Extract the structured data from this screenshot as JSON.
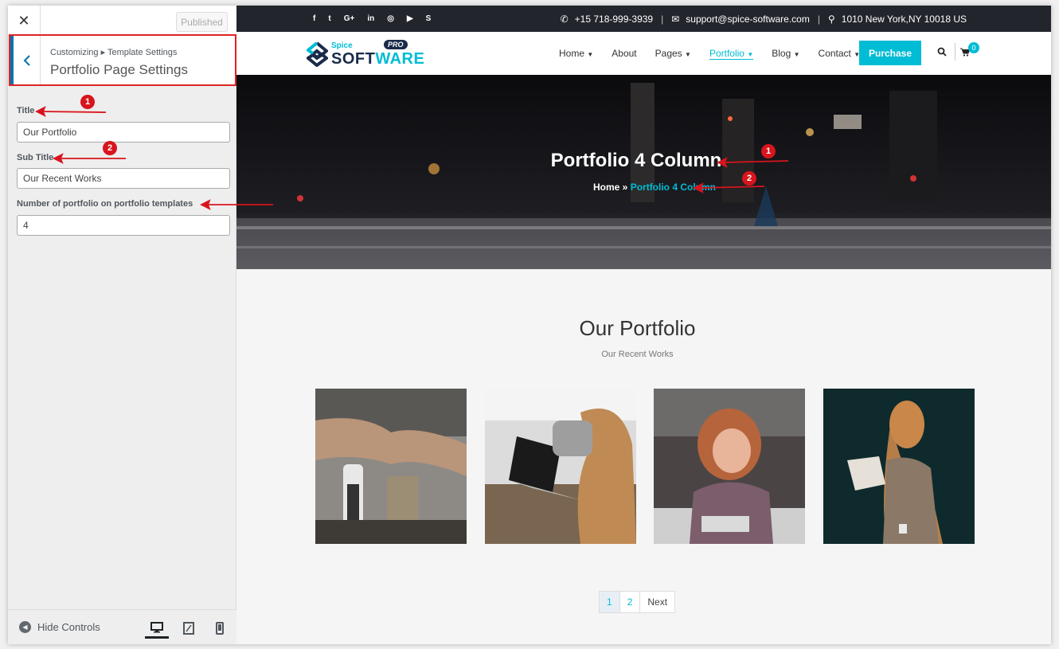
{
  "customizer": {
    "close_icon": "✕",
    "published_label": "Published",
    "breadcrumb": "Customizing ▸ Template Settings",
    "section_title": "Portfolio Page Settings",
    "controls": [
      {
        "label": "Title",
        "value": "Our Portfolio"
      },
      {
        "label": "Sub Title",
        "value": "Our Recent Works"
      },
      {
        "label": "Number of portfolio on portfolio templates",
        "value": "4"
      }
    ],
    "hide_controls_label": "Hide Controls",
    "devices": [
      "desktop",
      "tablet",
      "mobile"
    ]
  },
  "site": {
    "topbar": {
      "social_icons": [
        "facebook-icon",
        "twitter-icon",
        "google-plus-icon",
        "linkedin-icon",
        "instagram-icon",
        "youtube-icon",
        "skype-icon"
      ],
      "social_glyphs": [
        "f",
        "t",
        "G+",
        "in",
        "◎",
        "▶",
        "S"
      ],
      "phone": "+15 718-999-3939",
      "email": "support@spice-software.com",
      "address": "1010 New York,NY 10018 US"
    },
    "logo": {
      "small": "Spice",
      "big_left": "SOFT",
      "big_right": "WARE",
      "pro": "PRO"
    },
    "menu": [
      {
        "label": "Home",
        "dropdown": true
      },
      {
        "label": "About",
        "dropdown": false
      },
      {
        "label": "Pages",
        "dropdown": true
      },
      {
        "label": "Portfolio",
        "dropdown": true,
        "active": true
      },
      {
        "label": "Blog",
        "dropdown": true
      },
      {
        "label": "Contact",
        "dropdown": true
      }
    ],
    "purchase_label": "Purchase",
    "cart_count": "0",
    "hero": {
      "title": "Portfolio 4 Column",
      "breadcrumb_home": "Home",
      "breadcrumb_sep": "»",
      "breadcrumb_current": "Portfolio 4 Column"
    },
    "portfolio_title": "Our Portfolio",
    "portfolio_subtitle": "Our Recent Works",
    "pagination": [
      "1",
      "2",
      "Next"
    ]
  },
  "annotations": {
    "badge_1": "1",
    "badge_2": "2"
  },
  "colors": {
    "accent": "#00bcd4",
    "annotation": "#d8141d",
    "topbar_bg": "#22252c"
  }
}
